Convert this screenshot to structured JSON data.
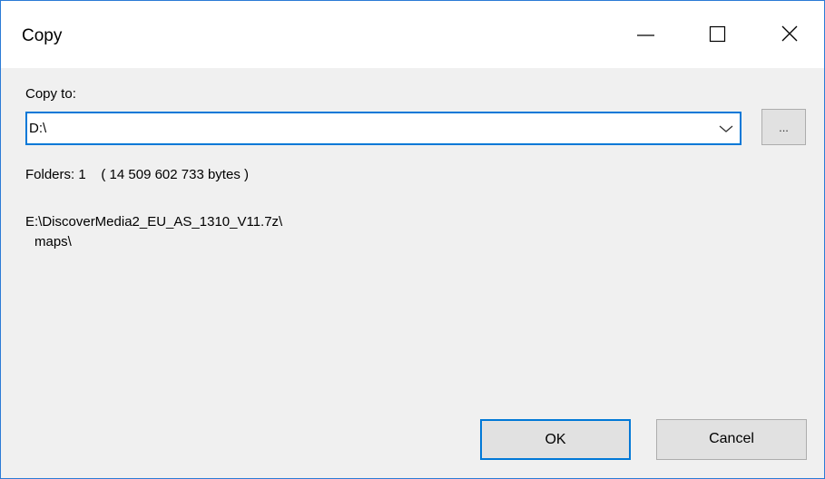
{
  "window": {
    "title": "Copy",
    "controls": {
      "minimize": "minimize-icon",
      "maximize": "maximize-icon",
      "close": "close-icon"
    }
  },
  "copy_to": {
    "label": "Copy to:",
    "value": "D:\\",
    "browse_label": "..."
  },
  "summary": {
    "folders_text": "Folders: 1    ( 14 509 602 733 bytes )"
  },
  "source": {
    "path_line1": "E:\\DiscoverMedia2_EU_AS_1310_V11.7z\\",
    "path_line2": "maps\\"
  },
  "buttons": {
    "ok_label": "OK",
    "cancel_label": "Cancel"
  },
  "colors": {
    "accent": "#0078d7",
    "dialog_background": "#f0f0f0",
    "button_background": "#e1e1e1"
  }
}
